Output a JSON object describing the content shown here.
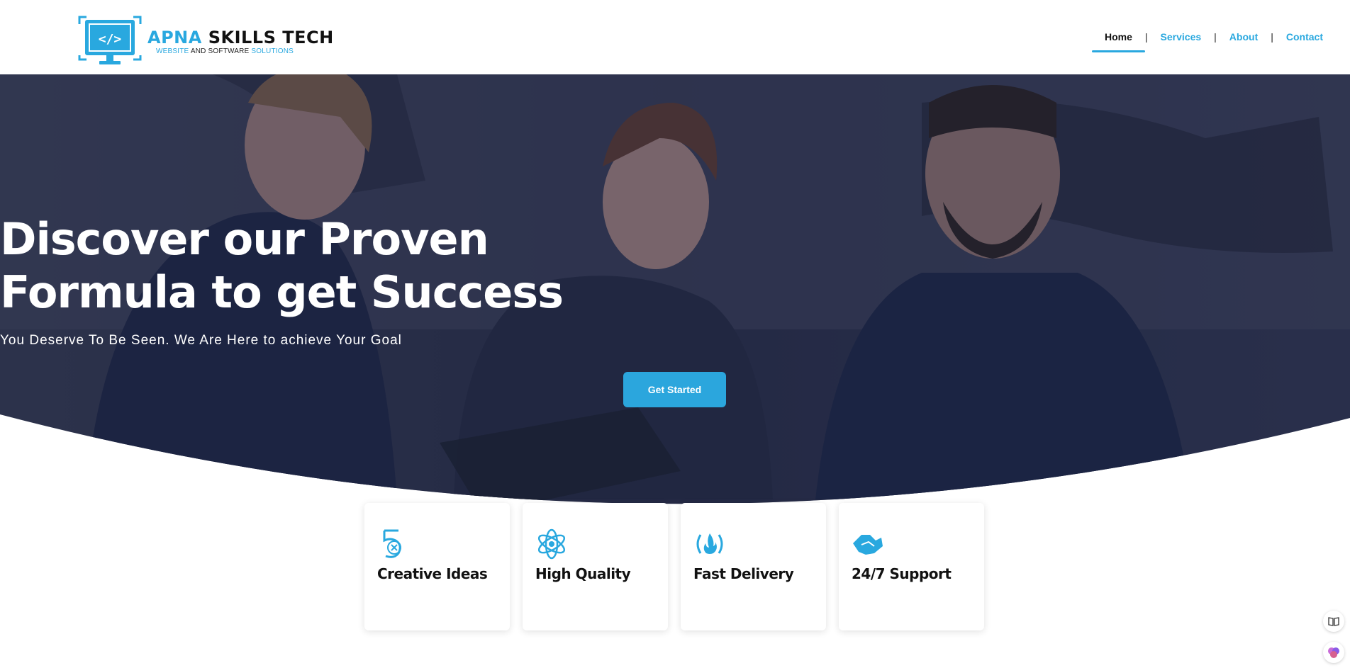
{
  "header": {
    "logo": {
      "title_accent": "APNA",
      "title_dark": "SKILLS TECH",
      "sub_accent_1": "WEBSITE",
      "sub_dark": "AND SOFTWARE",
      "sub_accent_2": "SOLUTIONS",
      "icon": "code-monitor-icon"
    },
    "nav": [
      {
        "label": "Home",
        "active": true
      },
      {
        "label": "Services",
        "active": false
      },
      {
        "label": "About",
        "active": false
      },
      {
        "label": "Contact",
        "active": false
      }
    ],
    "separator": "|"
  },
  "hero": {
    "title_line_1": "Discover our Proven",
    "title_line_2": "Formula to get Success",
    "subtitle": "You Deserve To Be Seen. We Are Here to achieve Your Goal",
    "cta_label": "Get Started"
  },
  "features": [
    {
      "title": "Creative Ideas",
      "icon": "five-badge-icon"
    },
    {
      "title": "High Quality",
      "icon": "atom-icon"
    },
    {
      "title": "Fast Delivery",
      "icon": "flame-code-icon"
    },
    {
      "title": "24/7 Support",
      "icon": "handshake-icon"
    }
  ],
  "colors": {
    "accent": "#29a8df",
    "hero_overlay": "#1c2340",
    "text_dark": "#111111"
  },
  "widgets": [
    {
      "icon": "reader-icon"
    },
    {
      "icon": "brain-icon"
    }
  ]
}
